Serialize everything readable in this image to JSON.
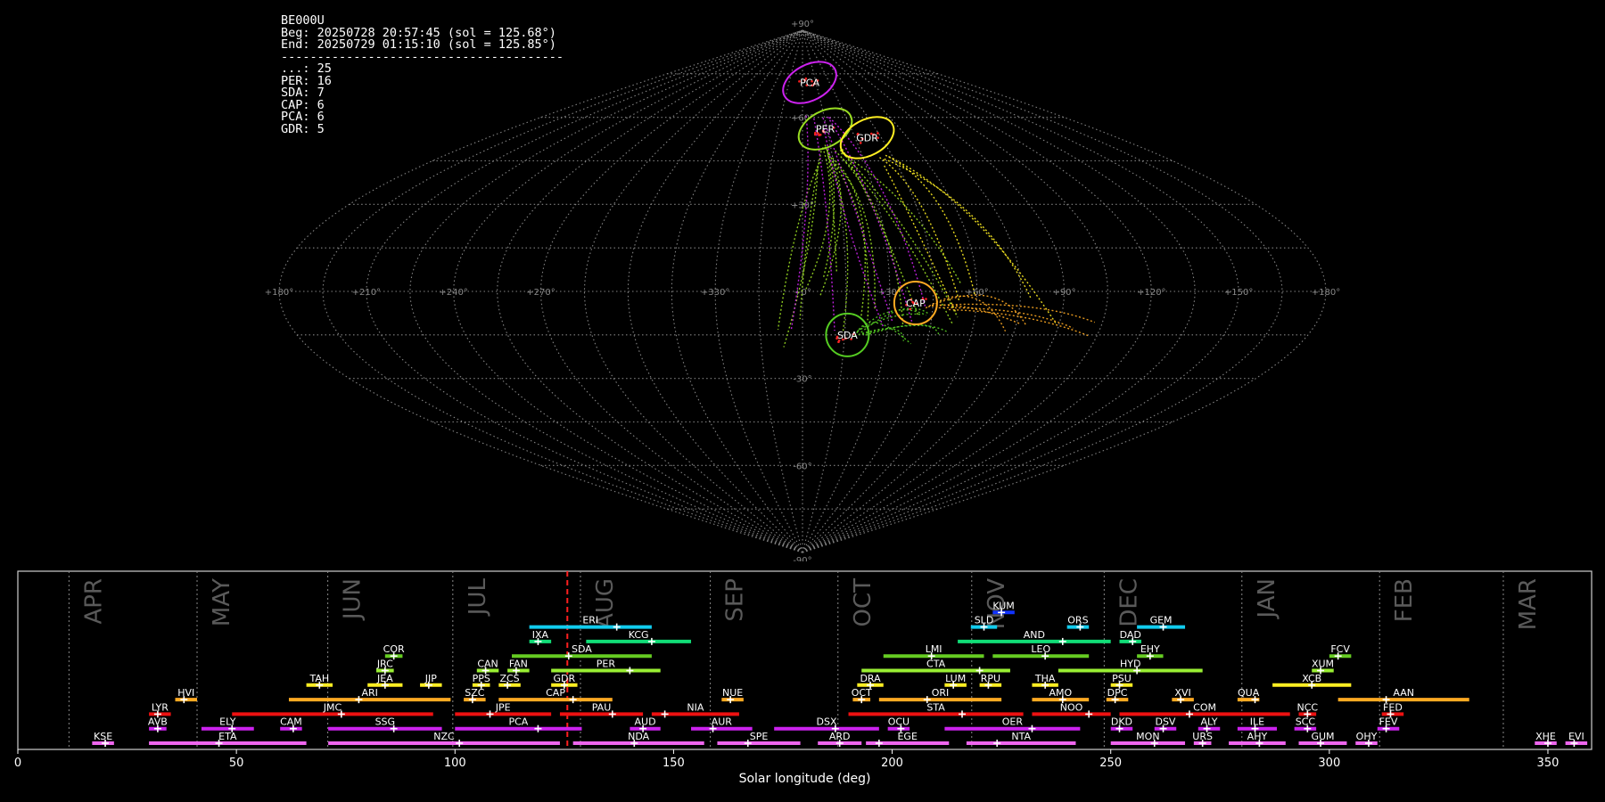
{
  "info": {
    "lines": [
      "BE000U",
      "Beg: 20250728 20:57:45 (sol = 125.68°)",
      "End: 20250729 01:15:10 (sol = 125.85°)",
      "---------------------------------------",
      "...: 25",
      "PER: 16",
      "SDA: 7",
      "CAP: 6",
      "PCA: 6",
      "GDR: 5"
    ]
  },
  "chart_data": [
    {
      "type": "scatter",
      "projection": "sinusoidal",
      "lon_labels": [
        "+180°",
        "+150°",
        "+120°",
        "+90°",
        "+60°",
        "+30°",
        "+0°",
        "+330°",
        "+270°",
        "+240°",
        "+210°",
        "+180°"
      ],
      "lat_labels": [
        "+90°",
        "+60°",
        "+30°",
        "-30°",
        "-60°",
        "-90°"
      ],
      "grid": true,
      "radiants": [
        {
          "code": "PCA",
          "lon": -8,
          "lat": 72,
          "color": "#cc22ee"
        },
        {
          "code": "PER",
          "lon": -14,
          "lat": 56,
          "color": "#99dd22"
        },
        {
          "code": "GDR",
          "lon": -37,
          "lat": 53,
          "color": "#ffee22"
        },
        {
          "code": "CAP",
          "lon": -39,
          "lat": -4,
          "color": "#ffaa22"
        },
        {
          "code": "SDA",
          "lon": -16,
          "lat": -15,
          "color": "#55cc22"
        }
      ]
    },
    {
      "type": "timeline",
      "xlabel": "Solar longitude (deg)",
      "xlim": [
        0,
        360
      ],
      "xticks": [
        0,
        50,
        100,
        150,
        200,
        250,
        300,
        350
      ],
      "current_sol": 125.7,
      "months": [
        {
          "name": "APR",
          "start": 11.7
        },
        {
          "name": "MAY",
          "start": 41.0
        },
        {
          "name": "JUN",
          "start": 70.9
        },
        {
          "name": "JUL",
          "start": 99.5
        },
        {
          "name": "AUG",
          "start": 128.7
        },
        {
          "name": "SEP",
          "start": 158.4
        },
        {
          "name": "OCT",
          "start": 187.6
        },
        {
          "name": "NOV",
          "start": 218.2
        },
        {
          "name": "DEC",
          "start": 248.5
        },
        {
          "name": "JAN",
          "start": 280.0
        },
        {
          "name": "FEB",
          "start": 311.5
        },
        {
          "name": "MAR",
          "start": 339.8
        }
      ],
      "showers": [
        {
          "code": "KUM",
          "start": 223,
          "end": 228,
          "peak": 225,
          "row": 10,
          "color": "#1133ff"
        },
        {
          "code": "ERI",
          "start": 117,
          "end": 145,
          "peak": 137,
          "row": 9,
          "color": "#11ccee"
        },
        {
          "code": "SLD",
          "start": 218,
          "end": 224,
          "peak": 221,
          "row": 9,
          "color": "#11ccee"
        },
        {
          "code": "ORS",
          "start": 240,
          "end": 245,
          "peak": 243,
          "row": 9,
          "color": "#11ccee"
        },
        {
          "code": "GEM",
          "start": 256,
          "end": 267,
          "peak": 262,
          "row": 9,
          "color": "#11ccee"
        },
        {
          "code": "IXA",
          "start": 117,
          "end": 122,
          "peak": 119,
          "row": 8,
          "color": "#11dd77"
        },
        {
          "code": "KCG",
          "start": 130,
          "end": 154,
          "peak": 145,
          "row": 8,
          "color": "#11dd77"
        },
        {
          "code": "AND",
          "start": 215,
          "end": 250,
          "peak": 239,
          "row": 8,
          "color": "#11dd77"
        },
        {
          "code": "DAD",
          "start": 252,
          "end": 257,
          "peak": 255,
          "row": 8,
          "color": "#11dd77"
        },
        {
          "code": "COR",
          "start": 84,
          "end": 88,
          "peak": 86,
          "row": 7,
          "color": "#66cc22"
        },
        {
          "code": "SDA",
          "start": 113,
          "end": 145,
          "peak": 126,
          "row": 7,
          "color": "#66cc22"
        },
        {
          "code": "LMI",
          "start": 198,
          "end": 221,
          "peak": 209,
          "row": 7,
          "color": "#66cc22"
        },
        {
          "code": "LEO",
          "start": 223,
          "end": 245,
          "peak": 235,
          "row": 7,
          "color": "#66cc22"
        },
        {
          "code": "EHY",
          "start": 256,
          "end": 262,
          "peak": 259,
          "row": 7,
          "color": "#66cc22"
        },
        {
          "code": "FCV",
          "start": 300,
          "end": 305,
          "peak": 302,
          "row": 7,
          "color": "#66cc22"
        },
        {
          "code": "JRC",
          "start": 82,
          "end": 86,
          "peak": 84,
          "row": 6,
          "color": "#99ee33"
        },
        {
          "code": "CAN",
          "start": 105,
          "end": 110,
          "peak": 107,
          "row": 6,
          "color": "#99ee33"
        },
        {
          "code": "FAN",
          "start": 112,
          "end": 117,
          "peak": 114,
          "row": 6,
          "color": "#99ee33"
        },
        {
          "code": "PER",
          "start": 122,
          "end": 147,
          "peak": 140,
          "row": 6,
          "color": "#99ee33"
        },
        {
          "code": "CTA",
          "start": 193,
          "end": 227,
          "peak": 220,
          "row": 6,
          "color": "#99ee33"
        },
        {
          "code": "HYD",
          "start": 238,
          "end": 271,
          "peak": 256,
          "row": 6,
          "color": "#99ee33"
        },
        {
          "code": "XUM",
          "start": 296,
          "end": 301,
          "peak": 298,
          "row": 6,
          "color": "#99ee33"
        },
        {
          "code": "TAH",
          "start": 66,
          "end": 72,
          "peak": 69,
          "row": 5,
          "color": "#ffee22"
        },
        {
          "code": "JEA",
          "start": 80,
          "end": 88,
          "peak": 84,
          "row": 5,
          "color": "#ffee22"
        },
        {
          "code": "JIP",
          "start": 92,
          "end": 97,
          "peak": 94,
          "row": 5,
          "color": "#ffee22"
        },
        {
          "code": "PPS",
          "start": 104,
          "end": 108,
          "peak": 106,
          "row": 5,
          "color": "#ffee22"
        },
        {
          "code": "ZCS",
          "start": 110,
          "end": 115,
          "peak": 112,
          "row": 5,
          "color": "#ffee22"
        },
        {
          "code": "GDR",
          "start": 122,
          "end": 128,
          "peak": 125,
          "row": 5,
          "color": "#ffee22"
        },
        {
          "code": "DRA",
          "start": 192,
          "end": 198,
          "peak": 195,
          "row": 5,
          "color": "#ffee22"
        },
        {
          "code": "LUM",
          "start": 212,
          "end": 217,
          "peak": 214,
          "row": 5,
          "color": "#ffee22"
        },
        {
          "code": "RPU",
          "start": 220,
          "end": 225,
          "peak": 222,
          "row": 5,
          "color": "#ffee22"
        },
        {
          "code": "THA",
          "start": 232,
          "end": 238,
          "peak": 235,
          "row": 5,
          "color": "#ffee22"
        },
        {
          "code": "PSU",
          "start": 250,
          "end": 255,
          "peak": 252,
          "row": 5,
          "color": "#ffee22"
        },
        {
          "code": "XCB",
          "start": 287,
          "end": 305,
          "peak": 296,
          "row": 5,
          "color": "#ffee22"
        },
        {
          "code": "HVI",
          "start": 36,
          "end": 41,
          "peak": 38,
          "row": 4,
          "color": "#ffaa22"
        },
        {
          "code": "ARI",
          "start": 62,
          "end": 99,
          "peak": 78,
          "row": 4,
          "color": "#ffaa22"
        },
        {
          "code": "SZC",
          "start": 102,
          "end": 107,
          "peak": 104,
          "row": 4,
          "color": "#ffaa22"
        },
        {
          "code": "CAP",
          "start": 110,
          "end": 136,
          "peak": 127,
          "row": 4,
          "color": "#ffaa22"
        },
        {
          "code": "NUE",
          "start": 161,
          "end": 166,
          "peak": 163,
          "row": 4,
          "color": "#ffaa22"
        },
        {
          "code": "OCT",
          "start": 191,
          "end": 195,
          "peak": 193,
          "row": 4,
          "color": "#ffaa22"
        },
        {
          "code": "ORI",
          "start": 197,
          "end": 225,
          "peak": 208,
          "row": 4,
          "color": "#ffaa22"
        },
        {
          "code": "AMO",
          "start": 232,
          "end": 245,
          "peak": 239,
          "row": 4,
          "color": "#ffaa22"
        },
        {
          "code": "DPC",
          "start": 249,
          "end": 254,
          "peak": 251,
          "row": 4,
          "color": "#ffaa22"
        },
        {
          "code": "XVI",
          "start": 264,
          "end": 269,
          "peak": 266,
          "row": 4,
          "color": "#ffaa22"
        },
        {
          "code": "QUA",
          "start": 279,
          "end": 284,
          "peak": 283,
          "row": 4,
          "color": "#ffaa22"
        },
        {
          "code": "AAN",
          "start": 302,
          "end": 332,
          "peak": 313,
          "row": 4,
          "color": "#ffaa22"
        },
        {
          "code": "LYR",
          "start": 30,
          "end": 35,
          "peak": 32,
          "row": 3,
          "color": "#ee1111"
        },
        {
          "code": "JMC",
          "start": 49,
          "end": 95,
          "peak": 74,
          "row": 3,
          "color": "#ee1111"
        },
        {
          "code": "JPE",
          "start": 100,
          "end": 122,
          "peak": 108,
          "row": 3,
          "color": "#ee1111"
        },
        {
          "code": "PAU",
          "start": 124,
          "end": 143,
          "peak": 136,
          "row": 3,
          "color": "#ee1111"
        },
        {
          "code": "NIA",
          "start": 145,
          "end": 165,
          "peak": 148,
          "row": 3,
          "color": "#ee1111"
        },
        {
          "code": "STA",
          "start": 190,
          "end": 230,
          "peak": 216,
          "row": 3,
          "color": "#ee1111"
        },
        {
          "code": "NOO",
          "start": 232,
          "end": 250,
          "peak": 245,
          "row": 3,
          "color": "#ee1111"
        },
        {
          "code": "COM",
          "start": 252,
          "end": 291,
          "peak": 268,
          "row": 3,
          "color": "#ee1111"
        },
        {
          "code": "NCC",
          "start": 293,
          "end": 297,
          "peak": 295,
          "row": 3,
          "color": "#ee1111"
        },
        {
          "code": "FED",
          "start": 312,
          "end": 317,
          "peak": 314,
          "row": 3,
          "color": "#ee1111"
        },
        {
          "code": "AVB",
          "start": 30,
          "end": 34,
          "peak": 32,
          "row": 2,
          "color": "#cc22ee"
        },
        {
          "code": "ELY",
          "start": 42,
          "end": 54,
          "peak": 49,
          "row": 2,
          "color": "#cc22ee"
        },
        {
          "code": "CAM",
          "start": 60,
          "end": 65,
          "peak": 63,
          "row": 2,
          "color": "#cc22ee"
        },
        {
          "code": "SSG",
          "start": 71,
          "end": 97,
          "peak": 86,
          "row": 2,
          "color": "#cc22ee"
        },
        {
          "code": "PCA",
          "start": 100,
          "end": 129,
          "peak": 119,
          "row": 2,
          "color": "#cc22ee"
        },
        {
          "code": "AUD",
          "start": 140,
          "end": 147,
          "peak": 143,
          "row": 2,
          "color": "#cc22ee"
        },
        {
          "code": "AUR",
          "start": 154,
          "end": 168,
          "peak": 159,
          "row": 2,
          "color": "#cc22ee"
        },
        {
          "code": "DSX",
          "start": 173,
          "end": 197,
          "peak": 187,
          "row": 2,
          "color": "#cc22ee"
        },
        {
          "code": "OCU",
          "start": 199,
          "end": 204,
          "peak": 202,
          "row": 2,
          "color": "#cc22ee"
        },
        {
          "code": "OER",
          "start": 212,
          "end": 243,
          "peak": 232,
          "row": 2,
          "color": "#cc22ee"
        },
        {
          "code": "DKD",
          "start": 250,
          "end": 255,
          "peak": 252,
          "row": 2,
          "color": "#cc22ee"
        },
        {
          "code": "DSV",
          "start": 260,
          "end": 265,
          "peak": 262,
          "row": 2,
          "color": "#cc22ee"
        },
        {
          "code": "ALY",
          "start": 270,
          "end": 275,
          "peak": 272,
          "row": 2,
          "color": "#cc22ee"
        },
        {
          "code": "ILE",
          "start": 279,
          "end": 288,
          "peak": 283,
          "row": 2,
          "color": "#cc22ee"
        },
        {
          "code": "SCC",
          "start": 292,
          "end": 297,
          "peak": 295,
          "row": 2,
          "color": "#cc22ee"
        },
        {
          "code": "FEV",
          "start": 311,
          "end": 316,
          "peak": 313,
          "row": 2,
          "color": "#cc22ee"
        },
        {
          "code": "KSE",
          "start": 17,
          "end": 22,
          "peak": 20,
          "row": 1,
          "color": "#ee66ee"
        },
        {
          "code": "ETA",
          "start": 30,
          "end": 66,
          "peak": 46,
          "row": 1,
          "color": "#ee66ee"
        },
        {
          "code": "NZC",
          "start": 71,
          "end": 124,
          "peak": 101,
          "row": 1,
          "color": "#ee66ee"
        },
        {
          "code": "NDA",
          "start": 127,
          "end": 157,
          "peak": 141,
          "row": 1,
          "color": "#ee66ee"
        },
        {
          "code": "SPE",
          "start": 160,
          "end": 179,
          "peak": 167,
          "row": 1,
          "color": "#ee66ee"
        },
        {
          "code": "ARD",
          "start": 183,
          "end": 193,
          "peak": 188,
          "row": 1,
          "color": "#ee66ee"
        },
        {
          "code": "EGE",
          "start": 194,
          "end": 213,
          "peak": 197,
          "row": 1,
          "color": "#ee66ee"
        },
        {
          "code": "NTA",
          "start": 217,
          "end": 242,
          "peak": 224,
          "row": 1,
          "color": "#ee66ee"
        },
        {
          "code": "MON",
          "start": 250,
          "end": 267,
          "peak": 260,
          "row": 1,
          "color": "#ee66ee"
        },
        {
          "code": "URS",
          "start": 269,
          "end": 273,
          "peak": 271,
          "row": 1,
          "color": "#ee66ee"
        },
        {
          "code": "AHY",
          "start": 277,
          "end": 290,
          "peak": 284,
          "row": 1,
          "color": "#ee66ee"
        },
        {
          "code": "GUM",
          "start": 293,
          "end": 304,
          "peak": 298,
          "row": 1,
          "color": "#ee66ee"
        },
        {
          "code": "OHY",
          "start": 306,
          "end": 311,
          "peak": 309,
          "row": 1,
          "color": "#ee66ee"
        },
        {
          "code": "XHE",
          "start": 347,
          "end": 352,
          "peak": 350,
          "row": 1,
          "color": "#ee66ee"
        },
        {
          "code": "EVI",
          "start": 354,
          "end": 359,
          "peak": 356,
          "row": 1,
          "color": "#ee66ee"
        }
      ]
    }
  ]
}
